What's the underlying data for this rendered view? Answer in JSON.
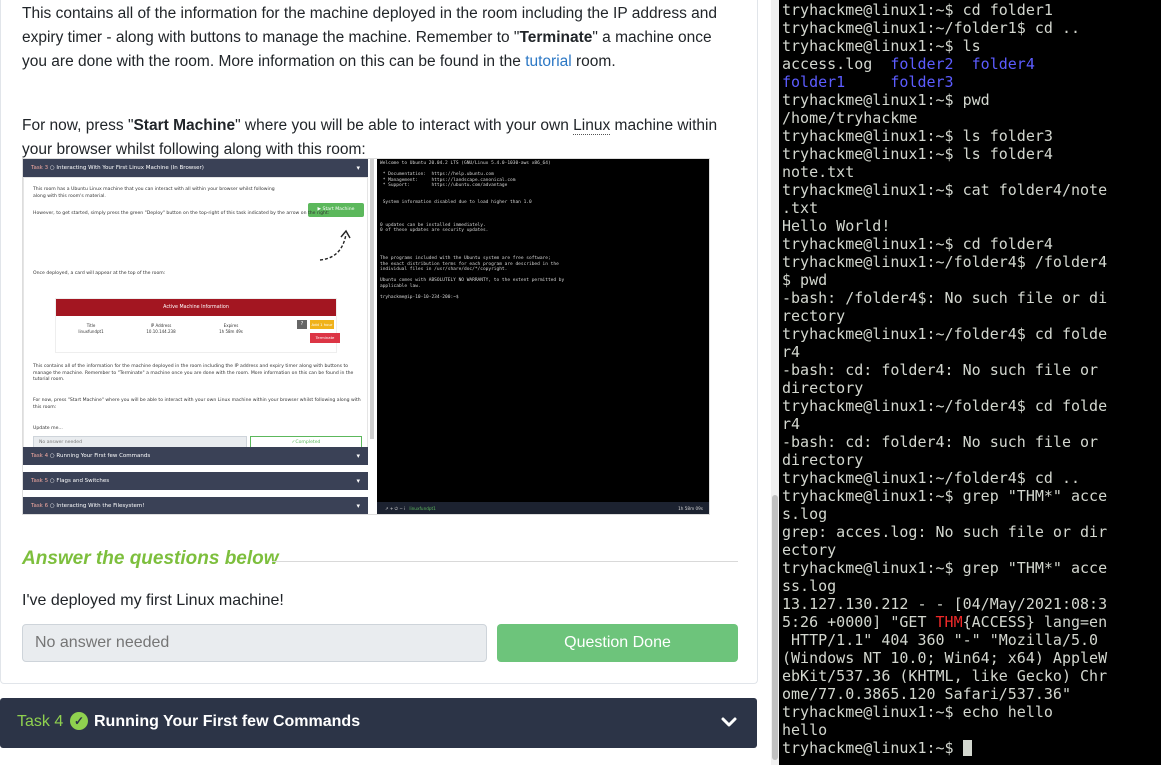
{
  "room_text": {
    "para1_a": "This contains all of the information for the machine deployed in the room including the IP address and expiry timer - along with buttons to manage the machine. Remember to \"",
    "para1_bold": "Terminate",
    "para1_b": "\" a machine once you are done with the room. More information on this can be found in the ",
    "para1_link": "tutorial",
    "para1_c": " room.",
    "para2_a": "For now, press \"",
    "para2_bold": "Start Machine",
    "para2_b": "\" where you will be able to interact with your own ",
    "para2_linux": "Linux",
    "para2_c": " machine within your browser whilst following along with this room:"
  },
  "embedded_screenshot": {
    "task3_label": "Task 3",
    "task3_title": "Interacting With Your First Linux Machine (In Browser)",
    "intro_text": "This room has a Ubuntu Linux machine that you can interact with all within your browser whilst following along with this room's material.",
    "get_started_text": "However, to get started, simply press the green \"Deploy\" button on the top-right of this task indicated by the arrow on the right:",
    "start_machine": "Start Machine",
    "card_text": "Once deployed, a card will appear at the top of the room:",
    "active_machine": "Active Machine Information",
    "col_title": "Title",
    "col_title_val": "linuxfundpt1",
    "col_ip": "IP Address",
    "col_ip_val": "10.10.144.238",
    "col_expires": "Expires",
    "col_expires_val": "1h 58m 49s",
    "add_hour": "Add 1 hour",
    "terminate": "Terminate",
    "mini_para1": "This contains all of the information for the machine deployed in the room including the IP address and expiry timer along with buttons to manage the machine. Remember to \"Terminate\" a machine once you are done with the room. More information on this can be found in the tutorial room.",
    "mini_para2": "For now, press \"Start Machine\" where you will be able to interact with your own Linux machine within your browser whilst following along with this room:",
    "update_me": "Update me...",
    "no_answer": "No answer needed",
    "completed": "Completed",
    "task4_label": "Task 4",
    "task4_title": "Running Your First few Commands",
    "task5_label": "Task 5",
    "task5_title": "Flags and Switches",
    "task6_label": "Task 6",
    "task6_title": "Interacting With the Filesystem!",
    "term_text": "Welcome to Ubuntu 20.04.2 LTS (GNU/Linux 5.4.0-1030-aws x86_64)\n\n * Documentation:  https://help.ubuntu.com\n * Management:     https://landscape.canonical.com\n * Support:        https://ubuntu.com/advantage\n\n\n System information disabled due to load higher than 1.0\n\n\n\n0 updates can be installed immediately.\n0 of these updates are security updates.\n\n\n\n\nThe programs included with the Ubuntu system are free software;\nthe exact distribution terms for each program are described in the\nindividual files in /usr/share/doc/*/copyright.\n\nUbuntu comes with ABSOLUTELY NO WARRANTY, to the extent permitted by\napplicable law.\n\ntryhackme@ip-10-10-234-200:~$ ",
    "bar_host": "linuxfundpt1",
    "bar_timer": "1h 58m 09s"
  },
  "answer_section": {
    "heading": "Answer the questions below",
    "question": "I've deployed my first Linux machine!",
    "placeholder": "No answer needed",
    "button": "Question Done"
  },
  "task4": {
    "label": "Task 4",
    "title": "Running Your First few Commands"
  },
  "terminal": {
    "lines": [
      "tryhackme@linux1:~$ cd folder1",
      "tryhackme@linux1:~/folder1$ cd ..",
      "tryhackme@linux1:~$ ls",
      "access.log  folder2  folder4",
      "folder1     folder3",
      "tryhackme@linux1:~$ pwd",
      "/home/tryhackme",
      "tryhackme@linux1:~$ ls folder3",
      "tryhackme@linux1:~$ ls folder4",
      "note.txt",
      "tryhackme@linux1:~$ cat folder4/note",
      ".txt",
      "Hello World!",
      "tryhackme@linux1:~$ cd folder4",
      "tryhackme@linux1:~/folder4$ /folder4",
      "$ pwd",
      "-bash: /folder4$: No such file or di",
      "rectory",
      "tryhackme@linux1:~/folder4$ cd folde",
      "r4",
      "-bash: cd: folder4: No such file or",
      "directory",
      "tryhackme@linux1:~/folder4$ cd folde",
      "r4",
      "-bash: cd: folder4: No such file or",
      "directory",
      "tryhackme@linux1:~/folder4$ cd ..",
      "tryhackme@linux1:~$ grep \"THM*\" acce",
      "s.log",
      "grep: acces.log: No such file or dir",
      "ectory",
      "tryhackme@linux1:~$ grep \"THM*\" acce",
      "ss.log",
      "13.127.130.212 - - [04/May/2021:08:3",
      "5:26 +0000] \"GET THM{ACCESS} lang=en",
      " HTTP/1.1\" 404 360 \"-\" \"Mozilla/5.0",
      "(Windows NT 10.0; Win64; x64) AppleW",
      "ebKit/537.36 (KHTML, like Gecko) Chr",
      "ome/77.0.3865.120 Safari/537.36\"",
      "tryhackme@linux1:~$ echo hello",
      "hello",
      "tryhackme@linux1:~$ "
    ],
    "ls_dirs_line1": [
      "folder2",
      "folder4"
    ],
    "ls_dirs_line2": [
      "folder1",
      "folder3"
    ],
    "highlight_word": "THM",
    "colors": {
      "background": "#000000",
      "text": "#d3d7cf",
      "dir": "#5c5cff",
      "highlight": "#ef2929"
    }
  }
}
